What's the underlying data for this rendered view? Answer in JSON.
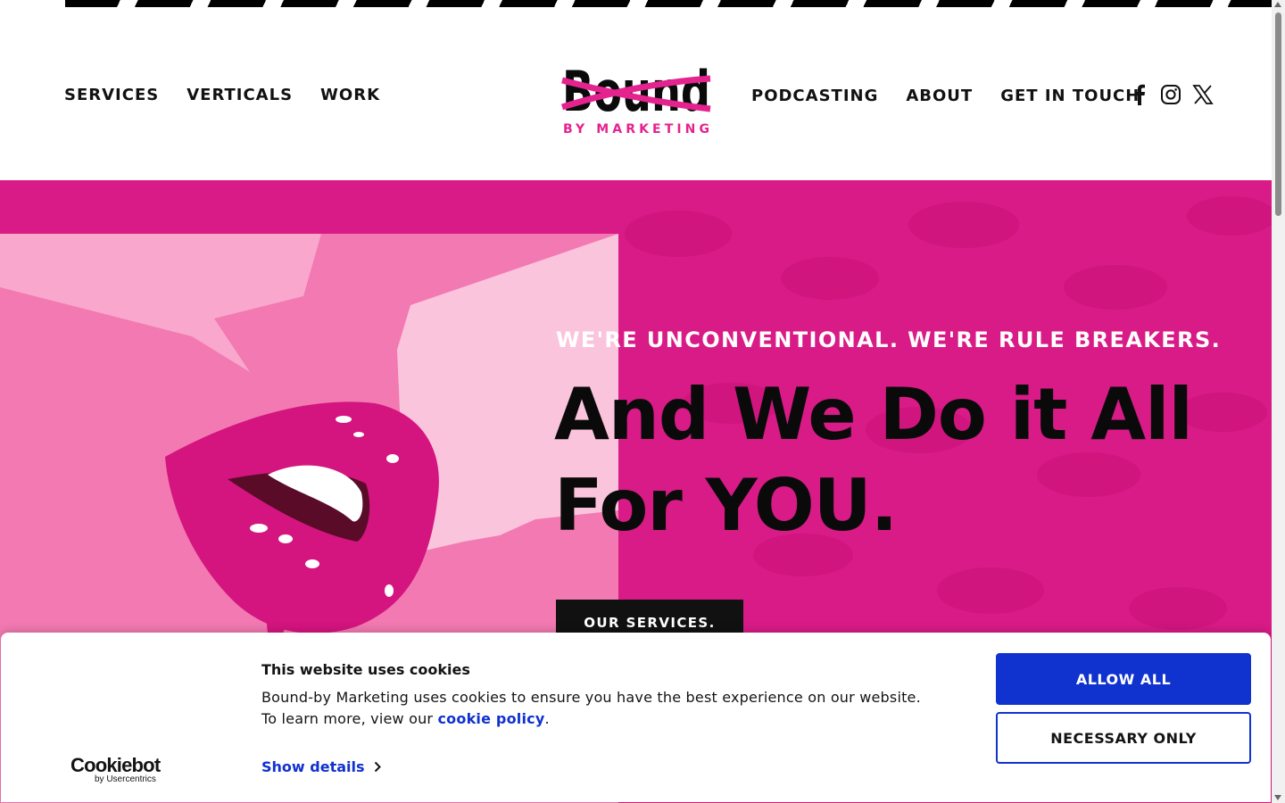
{
  "header": {
    "nav_left": [
      "SERVICES",
      "VERTICALS",
      "WORK"
    ],
    "nav_right": [
      "PODCASTING",
      "ABOUT",
      "GET IN TOUCH"
    ],
    "logo": {
      "word": "Bound",
      "sub": "BY MARKETING"
    },
    "social_icons": [
      "facebook-icon",
      "instagram-icon",
      "x-icon"
    ]
  },
  "hero": {
    "tagline": "WE'RE UNCONVENTIONAL. WE'RE RULE BREAKERS.",
    "headline_line1": "And We Do it All",
    "headline_line2": "For YOU.",
    "cta_label": "OUR SERVICES."
  },
  "cookie_banner": {
    "brand_main": "Cookiebot",
    "brand_sub": "by Usercentrics",
    "title": "This website uses cookies",
    "text_before_link": "Bound-by Marketing uses cookies to ensure you have the best experience on our website. To learn more, view our ",
    "link_text": "cookie policy",
    "text_after_link": ".",
    "show_details": "Show details",
    "allow_all": "ALLOW ALL",
    "necessary_only": "NECESSARY ONLY"
  },
  "colors": {
    "hero_pink": "#d81b86",
    "panel_pink": "#f279b1",
    "lips": "#d4147f",
    "cookie_blue": "#1032cf",
    "text_dark": "#111111"
  }
}
